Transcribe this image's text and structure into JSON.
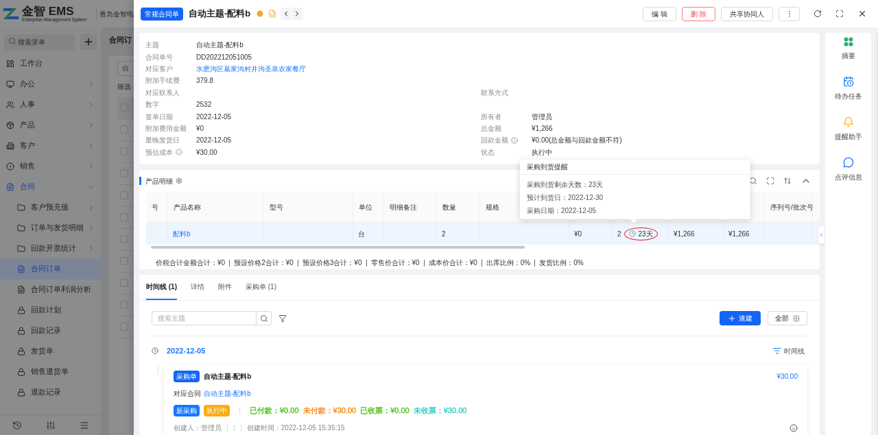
{
  "background": {
    "logo": {
      "brand": "金智 EMS",
      "tagline": "Enterprise Management System"
    },
    "company": "青岛金智电",
    "menu_search": {
      "placeholder": "搜索菜单"
    },
    "menu": [
      {
        "label": "工作台",
        "selected": false
      },
      {
        "label": "办公",
        "selected": false,
        "expanded": false
      },
      {
        "label": "人事",
        "selected": false,
        "expanded": false
      },
      {
        "label": "产品",
        "selected": false,
        "expanded": false
      },
      {
        "label": "客户",
        "selected": false,
        "expanded": false
      },
      {
        "label": "销售",
        "selected": false,
        "expanded": false
      },
      {
        "label": "合同",
        "selected": true,
        "expanded": true,
        "children": [
          {
            "label": "客户预充值",
            "selected": false,
            "expanded": false
          },
          {
            "label": "订单与发货明细",
            "selected": false,
            "expanded": false
          },
          {
            "label": "回款开票统计",
            "selected": false,
            "expanded": false
          },
          {
            "label": "合同订单",
            "selected": true
          },
          {
            "label": "合同订单利润分析",
            "selected": false
          },
          {
            "label": "回款计划",
            "selected": false
          },
          {
            "label": "回款记录",
            "selected": false
          },
          {
            "label": "发货单",
            "selected": false
          },
          {
            "label": "销售退货单",
            "selected": false
          },
          {
            "label": "退款记录",
            "selected": false
          }
        ]
      }
    ],
    "page_title": "合同订",
    "filter_value": "自",
    "filter_label": "筛选",
    "rows": [
      {
        "checked": false
      },
      {
        "checked": false
      },
      {
        "checked": false
      },
      {
        "checked": false
      },
      {
        "checked": false
      },
      {
        "checked": false
      },
      {
        "checked": false
      },
      {
        "checked": false
      },
      {
        "checked": false
      },
      {
        "checked": false
      },
      {
        "checked": false
      }
    ]
  },
  "drawer": {
    "type_tag": "常规合同单",
    "title": "自动主题-配料b",
    "actions": [
      {
        "kind": "default",
        "label": "编 辑"
      },
      {
        "kind": "danger",
        "label": "删 除"
      },
      {
        "kind": "default",
        "label": "共享协同人"
      },
      {
        "kind": "more"
      }
    ],
    "info_rows": [
      {
        "left": {
          "label": "主题",
          "value": "自动主题-配料b",
          "kind": "text"
        }
      },
      {
        "left": {
          "label": "合同单号",
          "value": "DD202212051005",
          "kind": "text"
        }
      },
      {
        "left": {
          "label": "对应客户",
          "value": "水磨沟区葛家沟村井沟圣泉农家餐厅",
          "kind": "link"
        }
      },
      {
        "left": {
          "label": "附加手续费",
          "value": "379.8",
          "kind": "text"
        }
      },
      {
        "left": {
          "label": "对应联系人"
        },
        "right": {
          "label": "联系方式"
        }
      },
      {
        "left": {
          "label": "数字",
          "value": "2532",
          "kind": "text"
        }
      },
      {
        "left": {
          "label": "签单日期",
          "value": "2022-12-05",
          "kind": "text"
        },
        "right": {
          "label": "所有者",
          "value": "管理员",
          "kind": "text"
        }
      },
      {
        "left": {
          "label": "附加费用金额",
          "value": "¥0",
          "kind": "text"
        },
        "right": {
          "label": "总金额",
          "value": "¥1,266",
          "kind": "text"
        }
      },
      {
        "left": {
          "label": "最晚发货日",
          "value": "2022-12-05",
          "kind": "text"
        },
        "right": {
          "label": "回款金额",
          "value": "¥0.00(总金额与回款金额不符)",
          "kind": "text",
          "info": true
        }
      },
      {
        "left": {
          "label": "预估成本",
          "value": "¥30.00",
          "kind": "text",
          "info": true
        },
        "right": {
          "label": "状态",
          "value": "执行中",
          "kind": "text"
        }
      }
    ],
    "products": {
      "title": "产品明细",
      "columns": [
        {
          "header": "号"
        },
        {
          "header": "产品名称",
          "cell": {
            "kind": "link",
            "text": "配料b"
          }
        },
        {
          "header": "型号"
        },
        {
          "header": "单位",
          "cell": {
            "kind": "text",
            "text": "台"
          }
        },
        {
          "header": "明细备注"
        },
        {
          "header": "数量",
          "cell": {
            "kind": "text",
            "text": "2"
          }
        },
        {
          "header": "规格"
        },
        {
          "cell": {
            "kind": "text",
            "text": "¥0"
          }
        },
        {
          "cell": {
            "kind": "arrival",
            "text": "2",
            "days": "23天",
            "highlighted": true
          }
        },
        {
          "cell": {
            "kind": "text",
            "text": "¥1,266"
          }
        },
        {
          "cell": {
            "kind": "text",
            "text": "¥1,266"
          }
        },
        {
          "header": "序列号/批次号"
        }
      ],
      "summary": [
        "价税合计金额合计：¥0",
        "预设价格2合计：¥0",
        "预设价格3合计：¥0",
        "零售价合计：¥0",
        "成本价合计：¥0",
        "出库比例：0%",
        "发货比例：0%"
      ],
      "tooltip": {
        "title": "采购到货提醒",
        "lines": [
          "采购到货剩余天数：23天",
          "预计到货日：2022-12-30",
          "采购日期：2022-12-05"
        ]
      }
    },
    "timeline": {
      "tabs": [
        {
          "label": "时间线 (1)",
          "selected": true
        },
        {
          "label": "详情",
          "selected": false
        },
        {
          "label": "附件",
          "selected": false
        },
        {
          "label": "采购单 (1)",
          "selected": false
        }
      ],
      "search": {
        "placeholder": "搜索主题"
      },
      "quick_create": "速建",
      "all_button": "全部",
      "view_toggle": "时间线",
      "groups": [
        {
          "date": "2022-12-05",
          "entries": [
            {
              "tag": "采购单",
              "title": "自动主题-配料b",
              "amount": "¥30.00",
              "contract_label": "对应合同",
              "contract_link": "自动主题-配料b",
              "badges": [
                {
                  "label": "新采购",
                  "color": "#1677ff"
                },
                {
                  "label": "执行中",
                  "color": "#faad14"
                }
              ],
              "stats": [
                {
                  "label": "已付款：¥0.00",
                  "color": "#52c41a"
                },
                {
                  "label": "未付款：¥30.00",
                  "color": "#fa8c16"
                },
                {
                  "label": "已收票：¥0.00",
                  "color": "#52c41a"
                },
                {
                  "label": "未收票：¥30.00",
                  "color": "#36cfc9"
                }
              ],
              "creator": "创建人：管理员",
              "separator": ":",
              "created": "创建时间：2022-12-05 15:35:15"
            }
          ]
        }
      ]
    },
    "side_panel": [
      {
        "label": "摘要"
      },
      {
        "label": "待办任务"
      },
      {
        "label": "提醒助手"
      },
      {
        "label": "点评信息"
      }
    ]
  }
}
